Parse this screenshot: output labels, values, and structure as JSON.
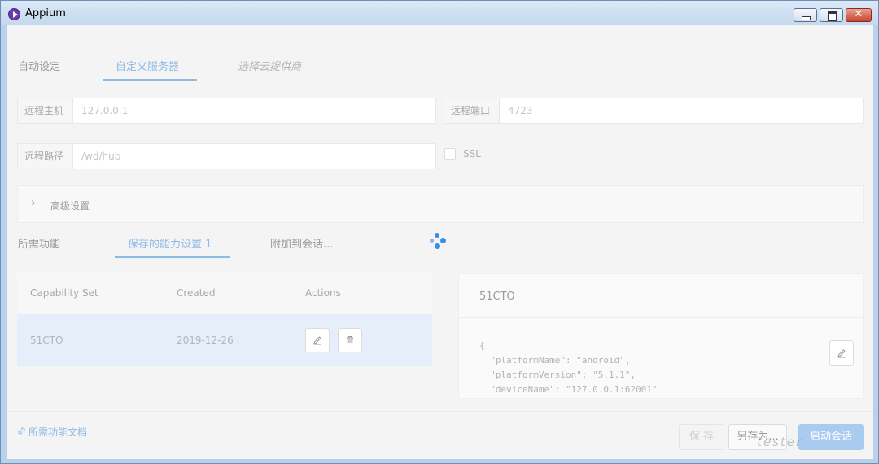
{
  "window": {
    "title": "Appium",
    "close_glyph": "✕"
  },
  "tabs": [
    {
      "label": "自动设定"
    },
    {
      "label": "自定义服务器"
    },
    {
      "label": "选择云提供商"
    }
  ],
  "server": {
    "host_label": "远程主机",
    "host_placeholder": "127.0.0.1",
    "port_label": "远程端口",
    "port_placeholder": "4723",
    "path_label": "远程路径",
    "path_placeholder": "/wd/hub",
    "ssl_label": "SSL"
  },
  "advanced": {
    "label": "高级设置",
    "chevron": "›"
  },
  "caps_tabs": [
    {
      "label": "所需功能"
    },
    {
      "label": "保存的能力设置 1"
    },
    {
      "label": "附加到会话..."
    }
  ],
  "table": {
    "headers": [
      "Capability Set",
      "Created",
      "Actions"
    ],
    "rows": [
      {
        "name": "51CTO",
        "created": "2019-12-26"
      }
    ]
  },
  "detail": {
    "title": "51CTO",
    "code": "{\n  \"platformName\": \"android\",\n  \"platformVersion\": \"5.1.1\",\n  \"deviceName\": \"127.0.0.1:62001\""
  },
  "footer": {
    "doc_link": "所需功能文档",
    "save": "保 存",
    "save_as": "另存为...",
    "start": "启动会话",
    "watermark": "tester"
  },
  "colors": {
    "accent": "#8db9e6",
    "spinner": "#3a8ee6",
    "selected_row": "#e6eef9"
  },
  "icons": {
    "app": "appium-icon",
    "edit": "pencil-icon",
    "delete": "trash-icon",
    "link": "link-icon"
  }
}
